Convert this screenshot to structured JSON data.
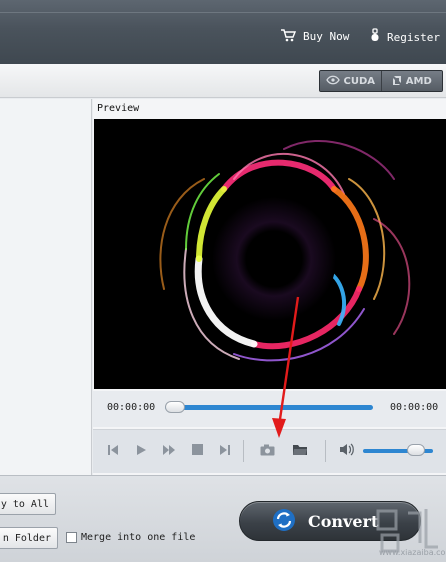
{
  "header": {
    "buy_now_label": "Buy Now",
    "register_label": "Register"
  },
  "gpu": {
    "cuda_label": "CUDA",
    "amd_label": "AMD"
  },
  "preview": {
    "label": "Preview",
    "current_time": "00:00:00",
    "end_time": "00:00:00",
    "progress_fraction": 0
  },
  "controls": {
    "volume_fraction": 0.85
  },
  "bottom": {
    "apply_to_all_label": "ly to All",
    "open_folder_label": "n Folder",
    "merge_label": "Merge into one file",
    "merge_checked": false,
    "convert_label": "Convert"
  },
  "watermark": {
    "text": "www.xiazaiba.com"
  },
  "colors": {
    "accent_blue": "#2d86d1",
    "annotation_red": "#e21b1b",
    "header_dark": "#4a535c"
  },
  "icons": {
    "cart": "cart-icon",
    "register": "key-icon",
    "skip_back": "skip-back-icon",
    "play": "play-icon",
    "fast_forward": "fast-forward-icon",
    "stop": "stop-icon",
    "skip_forward": "skip-forward-icon",
    "snapshot": "camera-icon",
    "open_folder": "folder-icon",
    "volume": "speaker-icon",
    "convert": "refresh-icon"
  }
}
